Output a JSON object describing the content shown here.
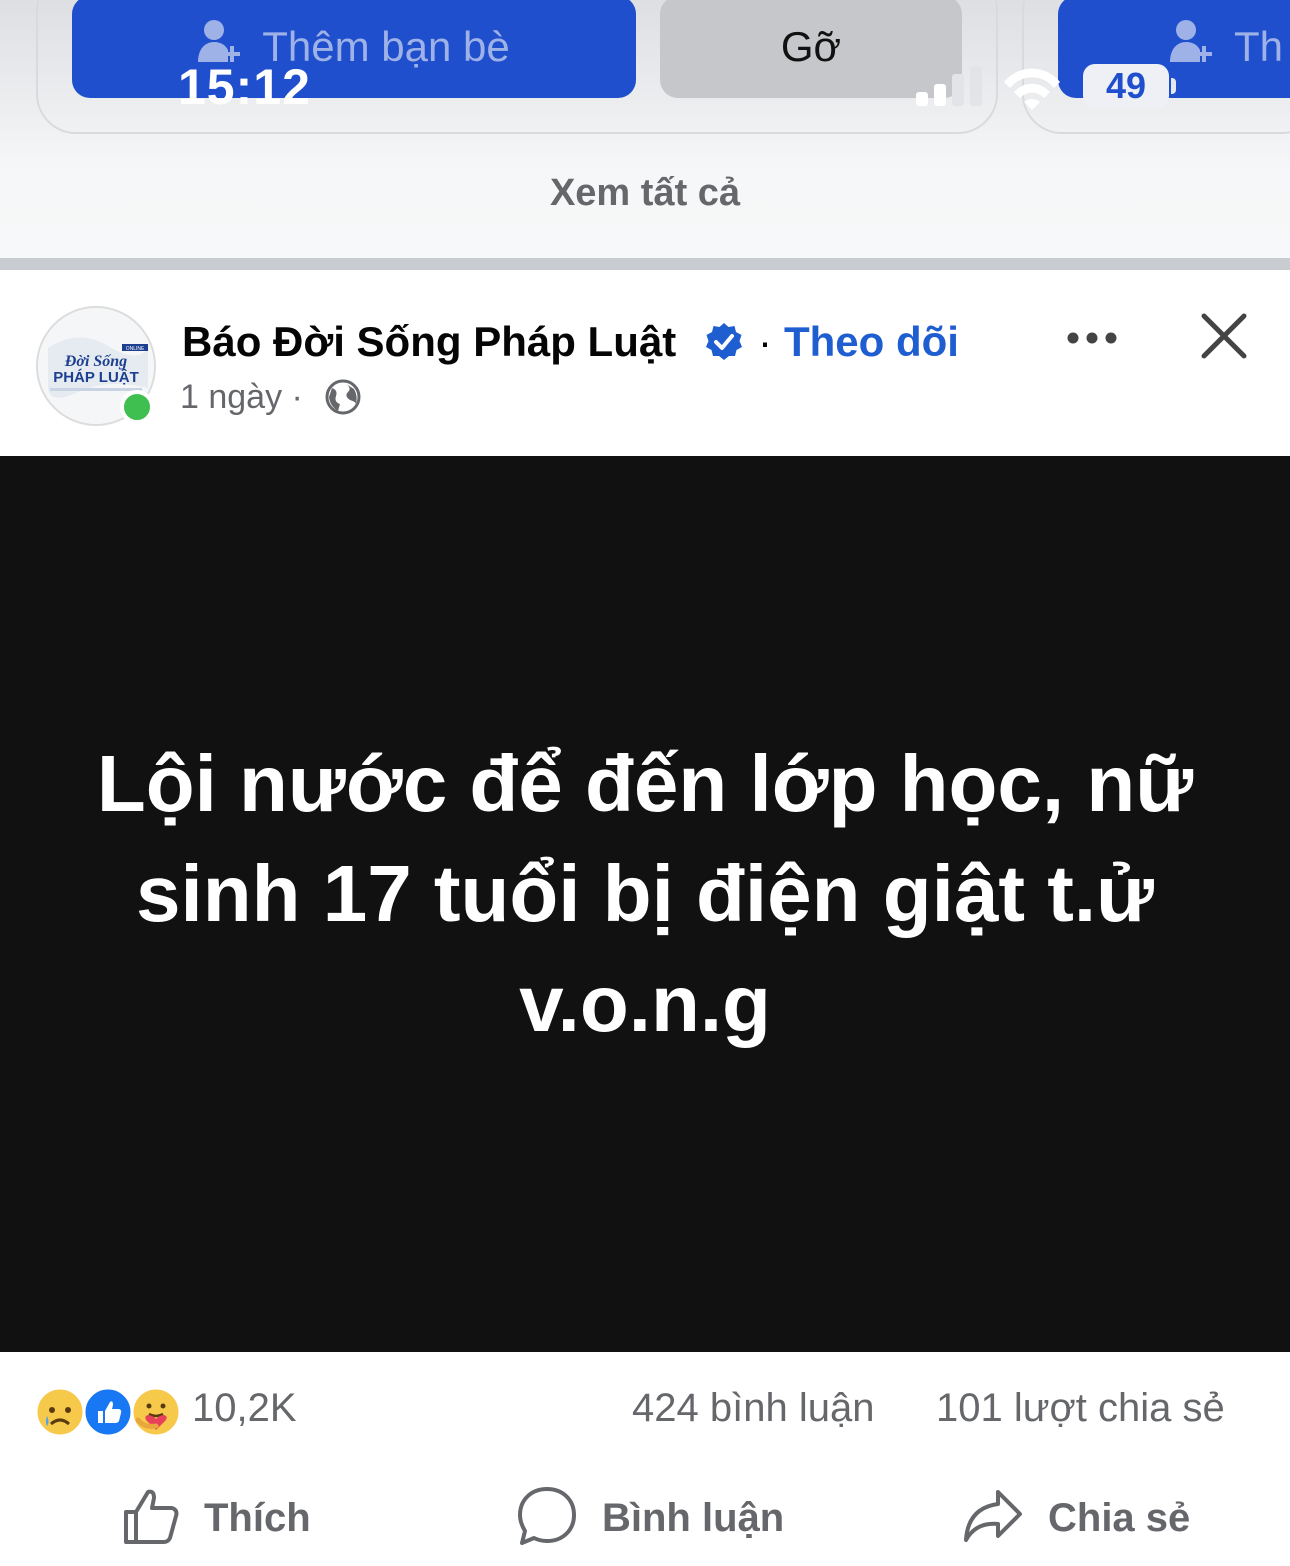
{
  "status_bar": {
    "time": "15:12",
    "battery": "49"
  },
  "suggestions": {
    "add_friend_label": "Thêm bạn bè",
    "remove_label": "Gỡ",
    "add_friend_partial_label": "Th",
    "see_all": "Xem tất cả"
  },
  "post": {
    "page_name": "Báo Đời Sống Pháp Luật",
    "separator": "·",
    "follow_label": "Theo dõi",
    "time_ago": "1 ngày ·",
    "avatar_logo": "Đời Sống & PHÁP LUẬT ONLINE",
    "headline": "Lội nước để đến lớp học, nữ sinh 17 tuổi bị điện giật t.ử v.o.n.g",
    "reaction_count": "10,2K",
    "comments": "424 bình luận",
    "shares": "101 lượt chia sẻ"
  },
  "actions": {
    "like": "Thích",
    "comment": "Bình luận",
    "share": "Chia sẻ"
  },
  "icons": [
    "add-friend-icon",
    "signal-icon",
    "wifi-icon",
    "battery-icon",
    "verified-badge-icon",
    "globe-icon",
    "more-icon",
    "close-icon",
    "sad-reaction-icon",
    "like-reaction-icon",
    "care-reaction-icon",
    "like-icon",
    "comment-icon",
    "share-icon"
  ],
  "colors": {
    "accent": "#1f5ed1",
    "button_blue": "#1f4fcc",
    "muted": "#65676b",
    "image_bg": "#111111"
  }
}
